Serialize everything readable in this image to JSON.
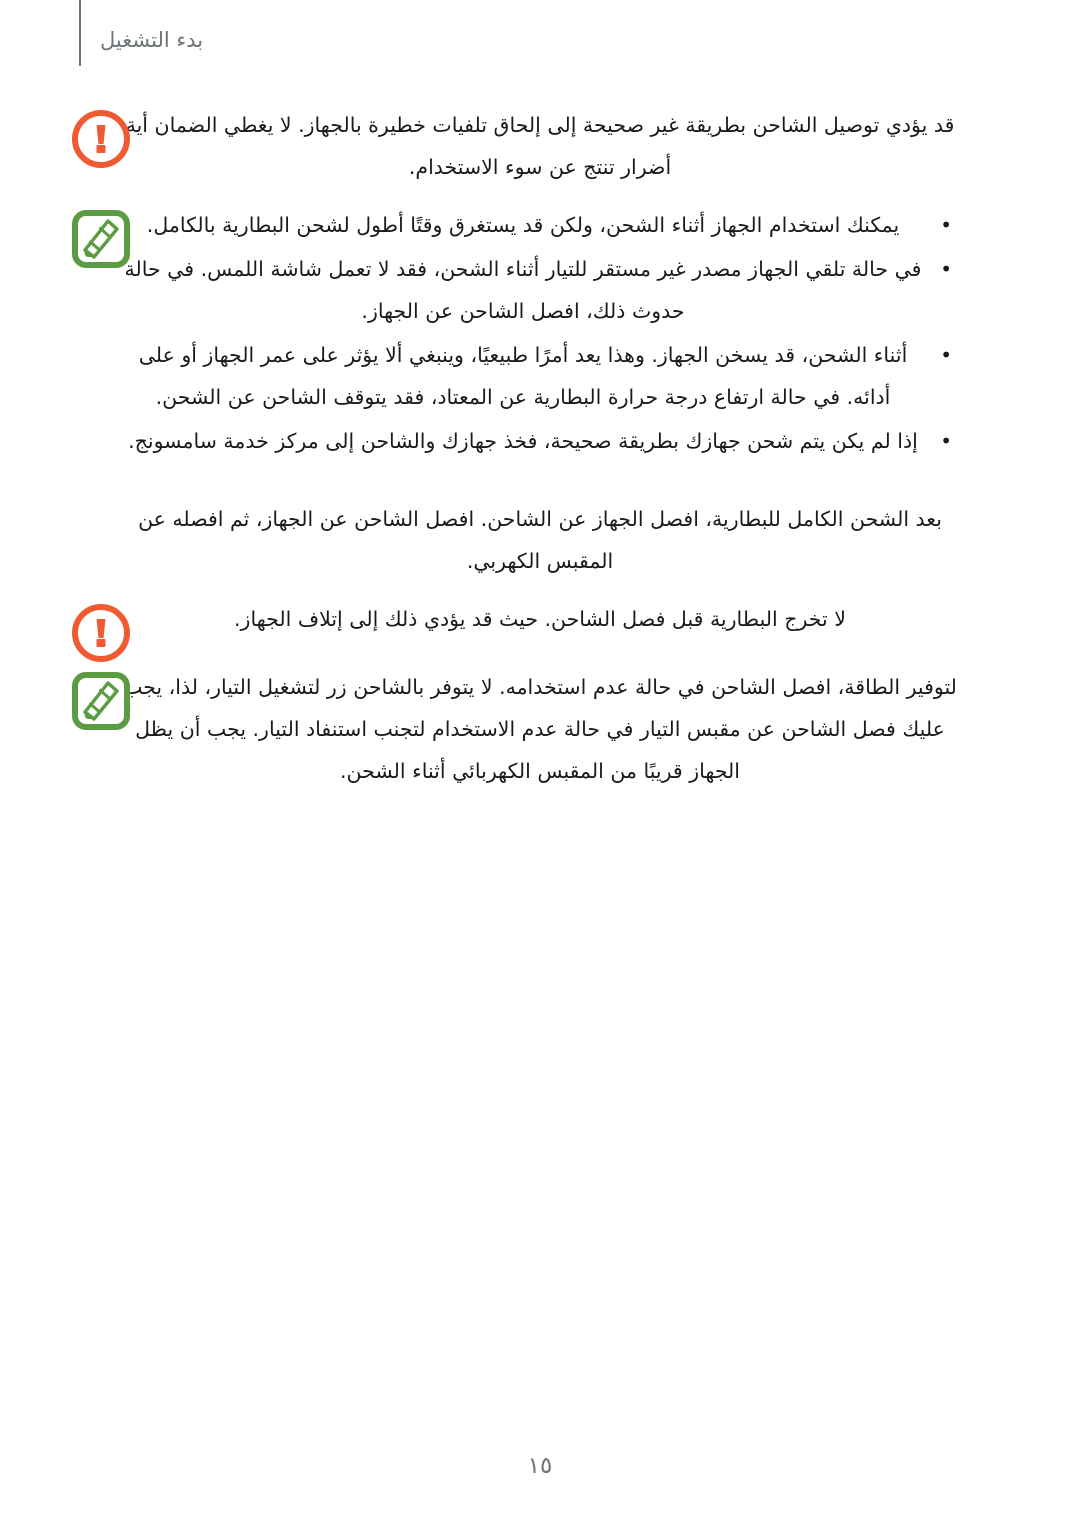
{
  "document": {
    "language": "ar",
    "direction": "rtl",
    "header_title": "بدء التشغيل",
    "page_number": "١٥",
    "colors": {
      "warning_orange": "#f05a32",
      "note_green": "#5b9b41",
      "header_gray": "#6e7578",
      "body_text": "#1b1b1b",
      "background": "#ffffff"
    }
  },
  "blocks": [
    {
      "id": "warning-charger",
      "type": "warning",
      "icon": "warning-exclamation-circle-icon",
      "paragraphs": [
        "قد يؤدي توصيل الشاحن بطريقة غير صحيحة إلى إلحاق تلفيات خطيرة بالجهاز. لا يغطي الضمان أية أضرار تنتج عن سوء الاستخدام."
      ]
    },
    {
      "id": "note-charging-tips",
      "type": "note",
      "icon": "note-pencil-icon",
      "bullets": [
        "يمكنك استخدام الجهاز أثناء الشحن، ولكن قد يستغرق وقتًا أطول لشحن البطارية بالكامل.",
        "في حالة تلقي الجهاز مصدر غير مستقر للتيار أثناء الشحن، فقد لا تعمل شاشة اللمس. في حالة حدوث ذلك، افصل الشاحن عن الجهاز.",
        "أثناء الشحن، قد يسخن الجهاز. وهذا يعد أمرًا طبيعيًا، وينبغي ألا يؤثر على عمر الجهاز أو على أدائه. في حالة ارتفاع درجة حرارة البطارية عن المعتاد، فقد يتوقف الشاحن عن الشحن.",
        "إذا لم يكن يتم شحن جهازك بطريقة صحيحة، فخذ جهازك والشاحن إلى مركز خدمة سامسونج."
      ]
    },
    {
      "id": "plain-disconnect",
      "type": "plain",
      "icon": null,
      "paragraphs": [
        "بعد الشحن الكامل للبطارية، افصل الجهاز عن الشاحن. افصل الشاحن عن الجهاز، ثم افصله عن المقبس الكهربي."
      ]
    },
    {
      "id": "warning-battery",
      "type": "warning",
      "icon": "warning-exclamation-circle-icon",
      "paragraphs": [
        "لا تخرج البطارية قبل فصل الشاحن. حيث قد يؤدي ذلك إلى إتلاف الجهاز."
      ]
    },
    {
      "id": "note-power-saving",
      "type": "note",
      "icon": "note-pencil-icon",
      "paragraphs": [
        "لتوفير الطاقة، افصل الشاحن في حالة عدم استخدامه. لا يتوفر بالشاحن زر لتشغيل التيار، لذا، يجب عليك فصل الشاحن عن مقبس التيار في حالة عدم الاستخدام لتجنب استنفاد التيار. يجب أن يظل الجهاز قريبًا من المقبس الكهربائي أثناء الشحن."
      ]
    }
  ]
}
